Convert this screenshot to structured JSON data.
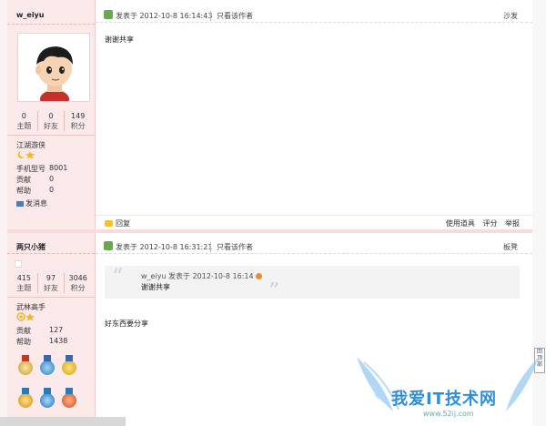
{
  "post1": {
    "username": "w_eiyu",
    "stats": [
      {
        "num": "0",
        "label": "主题"
      },
      {
        "num": "0",
        "label": "好友"
      },
      {
        "num": "149",
        "label": "积分"
      }
    ],
    "rank": "江湖游侠",
    "fields": [
      {
        "k": "手机型号",
        "v": "8001"
      },
      {
        "k": "贡献",
        "v": "0"
      },
      {
        "k": "帮助",
        "v": "0"
      }
    ],
    "message_label": "发消息",
    "time": "发表于 2012-10-8 16:14:43",
    "only_author": "只看该作者",
    "floor": "沙发",
    "content": "谢谢共享",
    "reply": "回复",
    "actions": [
      "使用道具",
      "评分",
      "举报"
    ]
  },
  "post2": {
    "username": "两只小猪",
    "stats": [
      {
        "num": "415",
        "label": "主题"
      },
      {
        "num": "97",
        "label": "好友"
      },
      {
        "num": "3046",
        "label": "积分"
      }
    ],
    "rank": "武林高手",
    "fields": [
      {
        "k": "贡献",
        "v": "127"
      },
      {
        "k": "帮助",
        "v": "1438"
      }
    ],
    "time": "发表于 2012-10-8 16:31:21",
    "only_author": "只看该作者",
    "floor": "板凳",
    "quote_header": "w_eiyu 发表于 2012-10-8 16:14",
    "quote_text": "谢谢共享",
    "content": "好东西要分享"
  },
  "side_tab": "回顶部",
  "watermark": {
    "text": "我爱IT技术网",
    "url": "www.52ij.com"
  },
  "colors": {
    "sidebar_bg": "#fce9ea",
    "accent_green": "#6aa84f",
    "watermark_blue": "#2f8fd6"
  }
}
